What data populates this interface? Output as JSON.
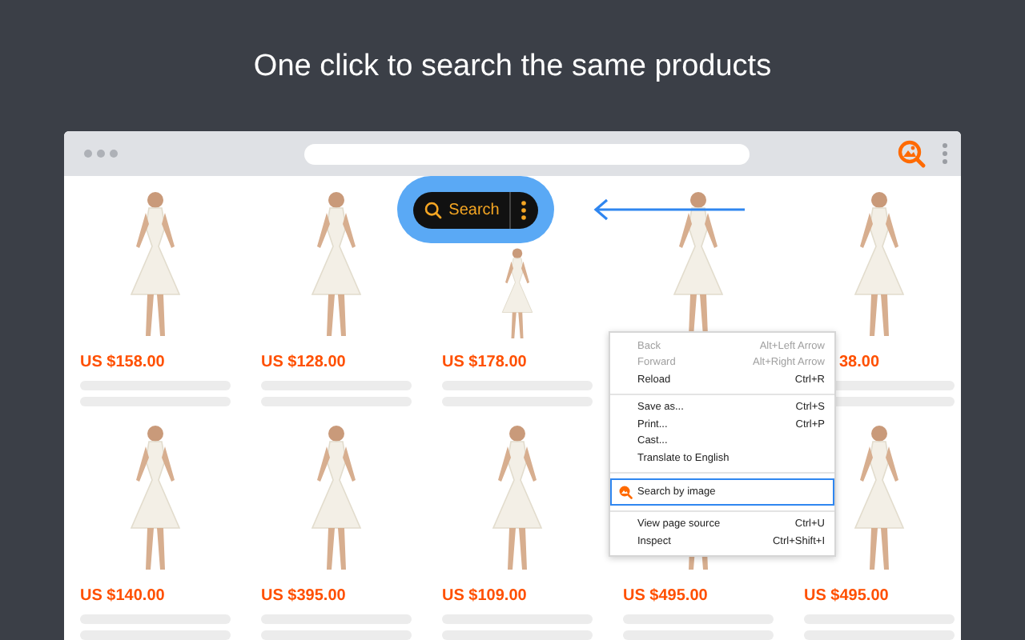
{
  "headline": "One click to search the same products",
  "search_pill": {
    "label": "Search"
  },
  "products": [
    [
      {
        "kind": "listing",
        "price": "US $158.00"
      },
      {
        "kind": "listing",
        "price": "US $128.00"
      },
      {
        "kind": "listing",
        "price": "US $178.00"
      },
      {
        "kind": "covered"
      },
      {
        "kind": "listing",
        "price": "38.00"
      }
    ],
    [
      {
        "kind": "listing",
        "price": "US $140.00"
      },
      {
        "kind": "listing",
        "price": "US $395.00"
      },
      {
        "kind": "listing",
        "price": "US $109.00"
      },
      {
        "kind": "listing",
        "price": "US $495.00"
      },
      {
        "kind": "listing",
        "price": "US $495.00"
      }
    ]
  ],
  "context_menu": {
    "groups": [
      [
        {
          "label": "Back",
          "shortcut": "Alt+Left Arrow",
          "disabled": true,
          "selected": false,
          "kind": "command"
        },
        {
          "label": "Forward",
          "shortcut": "Alt+Right Arrow",
          "disabled": true,
          "selected": false,
          "kind": "command"
        },
        {
          "label": "Reload",
          "shortcut": "Ctrl+R",
          "disabled": false,
          "selected": false,
          "kind": "command"
        }
      ],
      [
        {
          "label": "Save as...",
          "shortcut": "Ctrl+S",
          "disabled": false,
          "selected": false,
          "kind": "command"
        },
        {
          "label": "Print...",
          "shortcut": "Ctrl+P",
          "disabled": false,
          "selected": false,
          "kind": "command"
        },
        {
          "label": "Cast...",
          "disabled": false,
          "selected": false,
          "kind": "command"
        },
        {
          "label": "Translate to English",
          "disabled": false,
          "selected": false,
          "kind": "command"
        }
      ],
      [
        {
          "label": "Search by image",
          "disabled": false,
          "selected": true,
          "kind": "extension"
        }
      ],
      [
        {
          "label": "View page source",
          "shortcut": "Ctrl+U",
          "disabled": false,
          "selected": false,
          "kind": "command"
        },
        {
          "label": "Inspect",
          "shortcut": "Ctrl+Shift+I",
          "disabled": false,
          "selected": false,
          "kind": "command"
        }
      ]
    ]
  }
}
